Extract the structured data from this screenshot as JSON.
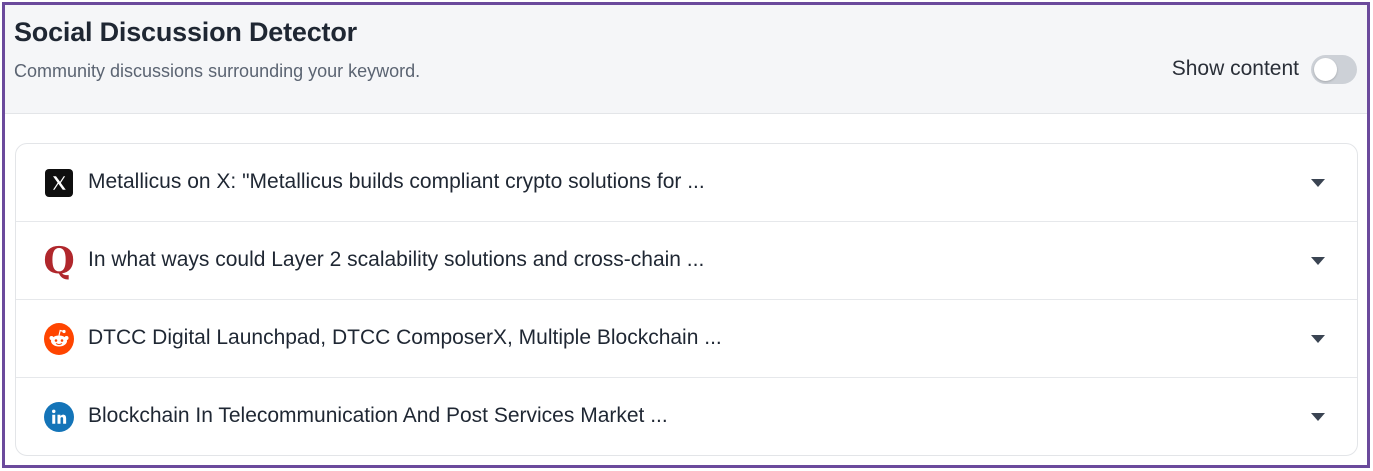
{
  "widget": {
    "title": "Social Discussion Detector",
    "subtitle": "Community discussions surrounding your keyword.",
    "toggle_label": "Show content",
    "toggle_on": false
  },
  "discussions": [
    {
      "source_icon": "x-icon",
      "text": "Metallicus on X: \"Metallicus builds compliant crypto solutions for ..."
    },
    {
      "source_icon": "quora-icon",
      "text": "In what ways could Layer 2 scalability solutions and cross-chain ..."
    },
    {
      "source_icon": "reddit-icon",
      "text": "DTCC Digital Launchpad, DTCC ComposerX, Multiple Blockchain ..."
    },
    {
      "source_icon": "linkedin-icon",
      "text": "Blockchain In Telecommunication And Post Services Market ..."
    }
  ],
  "colors": {
    "frame_border": "#6b4a9c",
    "quora": "#b0272c",
    "reddit": "#ff4500",
    "linkedin": "#1474b8",
    "x": "#0f0f0f"
  }
}
